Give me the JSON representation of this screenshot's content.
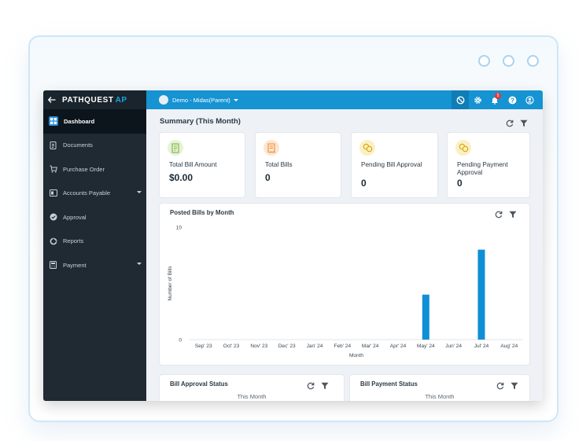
{
  "app": {
    "brand": "PATHQUEST",
    "brand_suffix": "AP",
    "org_selector": "Demo - Midas(Parent)",
    "notification_count": "5"
  },
  "sidebar": {
    "items": [
      {
        "label": "Dashboard",
        "icon": "dashboard-icon"
      },
      {
        "label": "Documents",
        "icon": "document-icon"
      },
      {
        "label": "Purchase Order",
        "icon": "cart-icon"
      },
      {
        "label": "Accounts Payable",
        "icon": "ledger-icon"
      },
      {
        "label": "Approval",
        "icon": "check-circle-icon"
      },
      {
        "label": "Reports",
        "icon": "pie-chart-icon"
      },
      {
        "label": "Payment",
        "icon": "calculator-icon"
      }
    ]
  },
  "summary": {
    "title": "Summary (This Month)",
    "cards": [
      {
        "label": "Total Bill Amount",
        "value": "$0.00",
        "icon": "invoice-icon",
        "color": "#7cb342"
      },
      {
        "label": "Total Bills",
        "value": "0",
        "icon": "receipt-icon",
        "color": "#f28b30"
      },
      {
        "label": "Pending Bill Approval",
        "value": "0",
        "icon": "coins-icon",
        "color": "#e8b923"
      },
      {
        "label": "Pending Payment Approval",
        "value": "0",
        "icon": "coins-icon",
        "color": "#e8b923"
      }
    ]
  },
  "posted_bills": {
    "title": "Posted Bills by Month"
  },
  "chart_data": {
    "type": "bar",
    "title": "Posted Bills by Month",
    "xlabel": "Month",
    "ylabel": "Number of Bills",
    "categories": [
      "Sep' 23",
      "Oct' 23",
      "Nov' 23",
      "Dec' 23",
      "Jan' 24",
      "Feb' 24",
      "Mar' 24",
      "Apr' 24",
      "May' 24",
      "Jun' 24",
      "Jul' 24",
      "Aug' 24"
    ],
    "values": [
      0,
      0,
      0,
      0,
      0,
      0,
      0,
      0,
      4,
      0,
      8,
      0
    ],
    "ylim": [
      0,
      10
    ],
    "yticks": [
      "0",
      "10"
    ],
    "color": "#0f8fd6",
    "grid": false
  },
  "bill_approval": {
    "title": "Bill Approval Status",
    "subtitle": "This Month"
  },
  "bill_payment": {
    "title": "Bill Payment Status",
    "subtitle": "This Month"
  }
}
